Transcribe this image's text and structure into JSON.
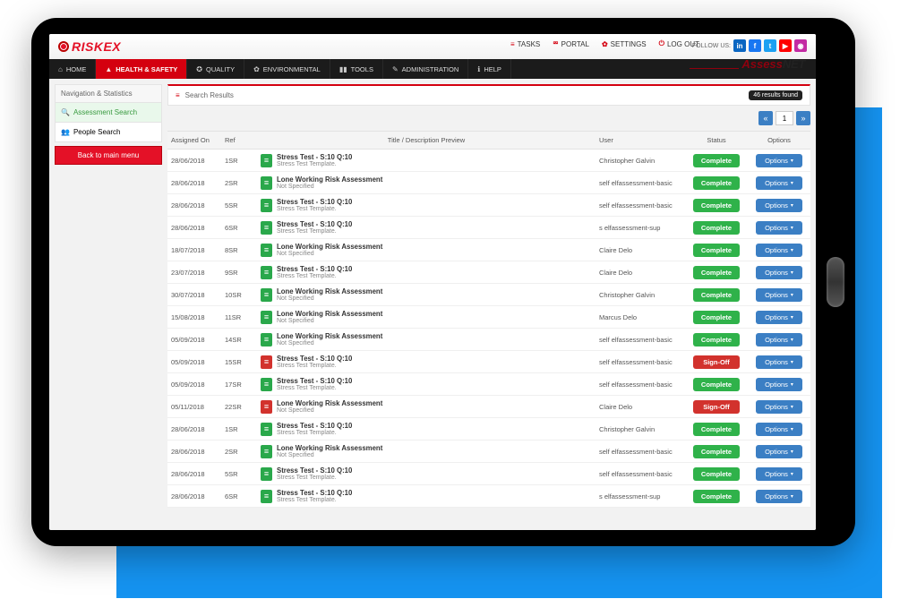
{
  "brand": {
    "riskex": "RISKEX",
    "assess": "Assess",
    "net": "NET"
  },
  "top_nav": {
    "tasks": "TASKS",
    "portal": "PORTAL",
    "settings": "SETTINGS",
    "logout": "LOG OUT",
    "follow": "FOLLOW US:"
  },
  "social": {
    "linkedin": {
      "glyph": "in",
      "bg": "#0a66c2"
    },
    "facebook": {
      "glyph": "f",
      "bg": "#1877f2"
    },
    "twitter": {
      "glyph": "t",
      "bg": "#1da1f2"
    },
    "youtube": {
      "glyph": "▶",
      "bg": "#ff0000"
    },
    "instagram": {
      "glyph": "◉",
      "bg": "#c32aa3"
    }
  },
  "menu": [
    {
      "icon": "⌂",
      "label": "HOME"
    },
    {
      "icon": "▲",
      "label": "HEALTH & SAFETY",
      "active": true
    },
    {
      "icon": "✪",
      "label": "QUALITY"
    },
    {
      "icon": "✿",
      "label": "ENVIRONMENTAL"
    },
    {
      "icon": "▮▮",
      "label": "TOOLS"
    },
    {
      "icon": "✎",
      "label": "ADMINISTRATION"
    },
    {
      "icon": "ℹ",
      "label": "HELP"
    }
  ],
  "sidebar": {
    "title": "Navigation & Statistics",
    "assessment": "Assessment Search",
    "people": "People Search",
    "back": "Back to main menu"
  },
  "search": {
    "title": "Search Results",
    "count_badge": "46 results found"
  },
  "pager": {
    "prev": "«",
    "value": "1",
    "next": "»"
  },
  "table": {
    "headers": {
      "assigned": "Assigned On",
      "ref": "Ref",
      "title": "Title / Description Preview",
      "user": "User",
      "status": "Status",
      "options": "Options"
    },
    "options_label": "Options",
    "caret": "▾",
    "rows": [
      {
        "date": "28/06/2018",
        "ref": "1SR",
        "icon": "g",
        "title": "Stress Test - S:10 Q:10",
        "sub": "Stress Test Template.",
        "user": "Christopher Galvin",
        "status": "Complete",
        "status_cls": "green"
      },
      {
        "date": "28/06/2018",
        "ref": "2SR",
        "icon": "g",
        "title": "Lone Working Risk Assessment",
        "sub": "Not Specified",
        "user": "self elfassessment-basic",
        "status": "Complete",
        "status_cls": "green"
      },
      {
        "date": "28/06/2018",
        "ref": "5SR",
        "icon": "g",
        "title": "Stress Test - S:10 Q:10",
        "sub": "Stress Test Template.",
        "user": "self elfassessment-basic",
        "status": "Complete",
        "status_cls": "green"
      },
      {
        "date": "28/06/2018",
        "ref": "6SR",
        "icon": "g",
        "title": "Stress Test - S:10 Q:10",
        "sub": "Stress Test Template.",
        "user": "s elfassessment-sup",
        "status": "Complete",
        "status_cls": "green"
      },
      {
        "date": "18/07/2018",
        "ref": "8SR",
        "icon": "g",
        "title": "Lone Working Risk Assessment",
        "sub": "Not Specified",
        "user": "Claire Delo",
        "status": "Complete",
        "status_cls": "green"
      },
      {
        "date": "23/07/2018",
        "ref": "9SR",
        "icon": "g",
        "title": "Stress Test - S:10 Q:10",
        "sub": "Stress Test Template.",
        "user": "Claire Delo",
        "status": "Complete",
        "status_cls": "green"
      },
      {
        "date": "30/07/2018",
        "ref": "10SR",
        "icon": "g",
        "title": "Lone Working Risk Assessment",
        "sub": "Not Specified",
        "user": "Christopher Galvin",
        "status": "Complete",
        "status_cls": "green"
      },
      {
        "date": "15/08/2018",
        "ref": "11SR",
        "icon": "g",
        "title": "Lone Working Risk Assessment",
        "sub": "Not Specified",
        "user": "Marcus Delo",
        "status": "Complete",
        "status_cls": "green"
      },
      {
        "date": "05/09/2018",
        "ref": "14SR",
        "icon": "g",
        "title": "Lone Working Risk Assessment",
        "sub": "Not Specified",
        "user": "self elfassessment-basic",
        "status": "Complete",
        "status_cls": "green"
      },
      {
        "date": "05/09/2018",
        "ref": "15SR",
        "icon": "r",
        "title": "Stress Test - S:10 Q:10",
        "sub": "Stress Test Template.",
        "user": "self elfassessment-basic",
        "status": "Sign-Off",
        "status_cls": "red"
      },
      {
        "date": "05/09/2018",
        "ref": "17SR",
        "icon": "g",
        "title": "Stress Test - S:10 Q:10",
        "sub": "Stress Test Template.",
        "user": "self elfassessment-basic",
        "status": "Complete",
        "status_cls": "green"
      },
      {
        "date": "05/11/2018",
        "ref": "22SR",
        "icon": "r",
        "title": "Lone Working Risk Assessment",
        "sub": "Not Specified",
        "user": "Claire Delo",
        "status": "Sign-Off",
        "status_cls": "red"
      },
      {
        "date": "28/06/2018",
        "ref": "1SR",
        "icon": "g",
        "title": "Stress Test - S:10 Q:10",
        "sub": "Stress Test Template.",
        "user": "Christopher Galvin",
        "status": "Complete",
        "status_cls": "green"
      },
      {
        "date": "28/06/2018",
        "ref": "2SR",
        "icon": "g",
        "title": "Lone Working Risk Assessment",
        "sub": "Not Specified",
        "user": "self elfassessment-basic",
        "status": "Complete",
        "status_cls": "green"
      },
      {
        "date": "28/06/2018",
        "ref": "5SR",
        "icon": "g",
        "title": "Stress Test - S:10 Q:10",
        "sub": "Stress Test Template.",
        "user": "self elfassessment-basic",
        "status": "Complete",
        "status_cls": "green"
      },
      {
        "date": "28/06/2018",
        "ref": "6SR",
        "icon": "g",
        "title": "Stress Test - S:10 Q:10",
        "sub": "Stress Test Template.",
        "user": "s elfassessment-sup",
        "status": "Complete",
        "status_cls": "green"
      }
    ]
  }
}
